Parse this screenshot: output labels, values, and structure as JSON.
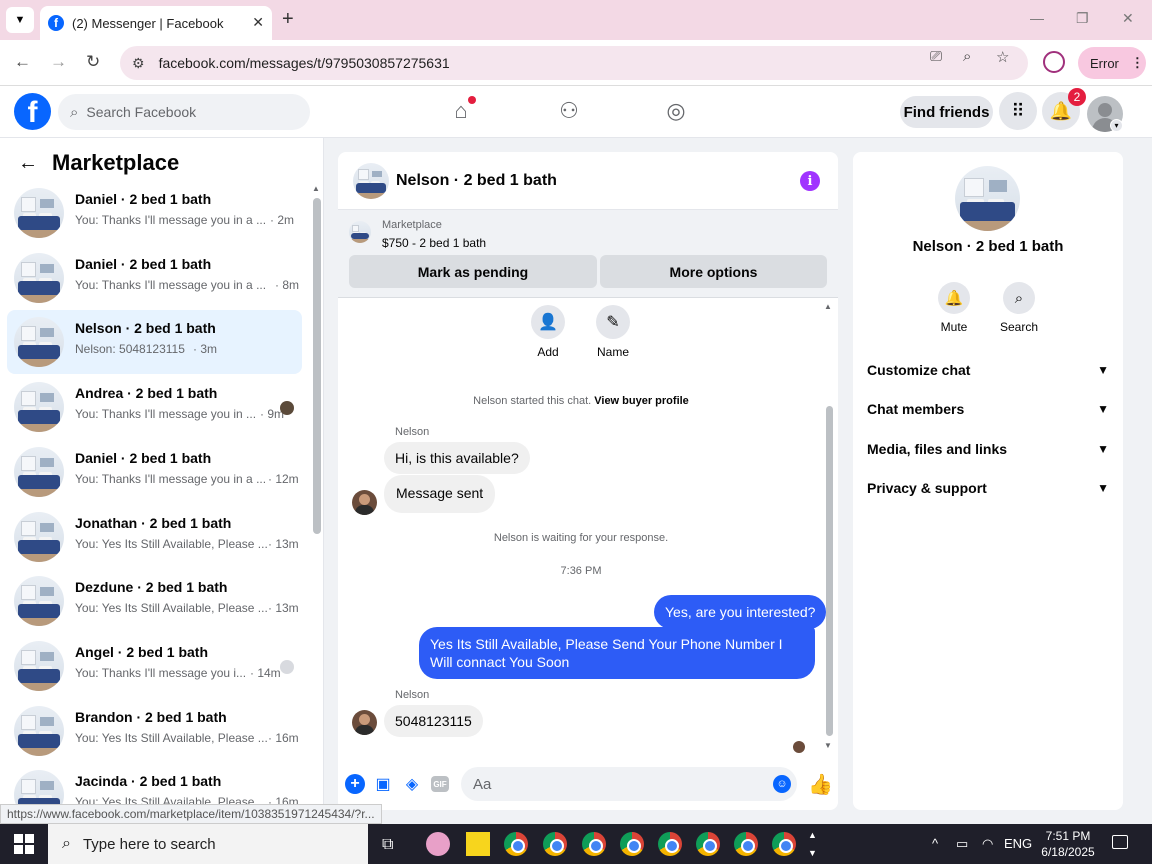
{
  "browser": {
    "tab_title": "(2) Messenger | Facebook",
    "url": "facebook.com/messages/t/9795030857275631",
    "error_label": "Error",
    "status_url": "https://www.facebook.com/marketplace/item/1038351971245434/?r..."
  },
  "fb_header": {
    "search_placeholder": "Search Facebook",
    "find_friends": "Find friends",
    "notification_count": "2"
  },
  "sidebar": {
    "title": "Marketplace",
    "conversations": [
      {
        "name": "Daniel · 2 bed 1 bath",
        "snippet": "You: Thanks I'll message you in a ...",
        "time": "· 2m",
        "active": false
      },
      {
        "name": "Daniel · 2 bed 1 bath",
        "snippet": "You: Thanks I'll message you in a ...",
        "time": "· 8m",
        "active": false
      },
      {
        "name": "Nelson · 2 bed 1 bath",
        "snippet": "Nelson: 5048123115",
        "time": "· 3m",
        "active": true
      },
      {
        "name": "Andrea · 2 bed 1 bath",
        "snippet": "You: Thanks I'll message you in ...",
        "time": "· 9m",
        "active": false
      },
      {
        "name": "Daniel · 2 bed 1 bath",
        "snippet": "You: Thanks I'll message you in a ...",
        "time": "· 12m",
        "active": false
      },
      {
        "name": "Jonathan · 2 bed 1 bath",
        "snippet": "You: Yes Its Still Available, Please ...",
        "time": "· 13m",
        "active": false
      },
      {
        "name": "Dezdune · 2 bed 1 bath",
        "snippet": "You: Yes Its Still Available, Please ...",
        "time": "· 13m",
        "active": false
      },
      {
        "name": "Angel · 2 bed 1 bath",
        "snippet": "You: Thanks I'll message you i...",
        "time": "· 14m",
        "active": false
      },
      {
        "name": "Brandon · 2 bed 1 bath",
        "snippet": "You: Yes Its Still Available, Please ...",
        "time": "· 16m",
        "active": false
      },
      {
        "name": "Jacinda · 2 bed 1 bath",
        "snippet": "You: Yes Its Still Available, Please ...",
        "time": "· 16m",
        "active": false
      }
    ]
  },
  "chat": {
    "title": "Nelson · 2 bed 1 bath",
    "marketplace_label": "Marketplace",
    "listing": "$750 - 2 bed 1 bath",
    "mark_pending": "Mark as pending",
    "more_options": "More options",
    "actions": {
      "add": "Add",
      "name": "Name"
    },
    "started_text": "Nelson started this chat.",
    "view_profile": "View buyer profile",
    "sender_name": "Nelson",
    "msg1": "Hi, is this available?",
    "msg2": "Message sent",
    "waiting": "Nelson is waiting for your response.",
    "timestamp": "7:36 PM",
    "out1": "Yes, are you interested?",
    "out2": "Yes Its Still Available, Please Send Your Phone Number I Will connact You Soon",
    "sender_name2": "Nelson",
    "msg3": "5048123115",
    "composer_placeholder": "Aa",
    "gif_label": "GIF"
  },
  "info_panel": {
    "title": "Nelson · 2 bed 1 bath",
    "mute": "Mute",
    "search": "Search",
    "sections": [
      "Customize chat",
      "Chat members",
      "Media, files and links",
      "Privacy & support"
    ]
  },
  "taskbar": {
    "search_placeholder": "Type here to search",
    "lang": "ENG",
    "time": "7:51 PM",
    "date": "6/18/2025"
  }
}
